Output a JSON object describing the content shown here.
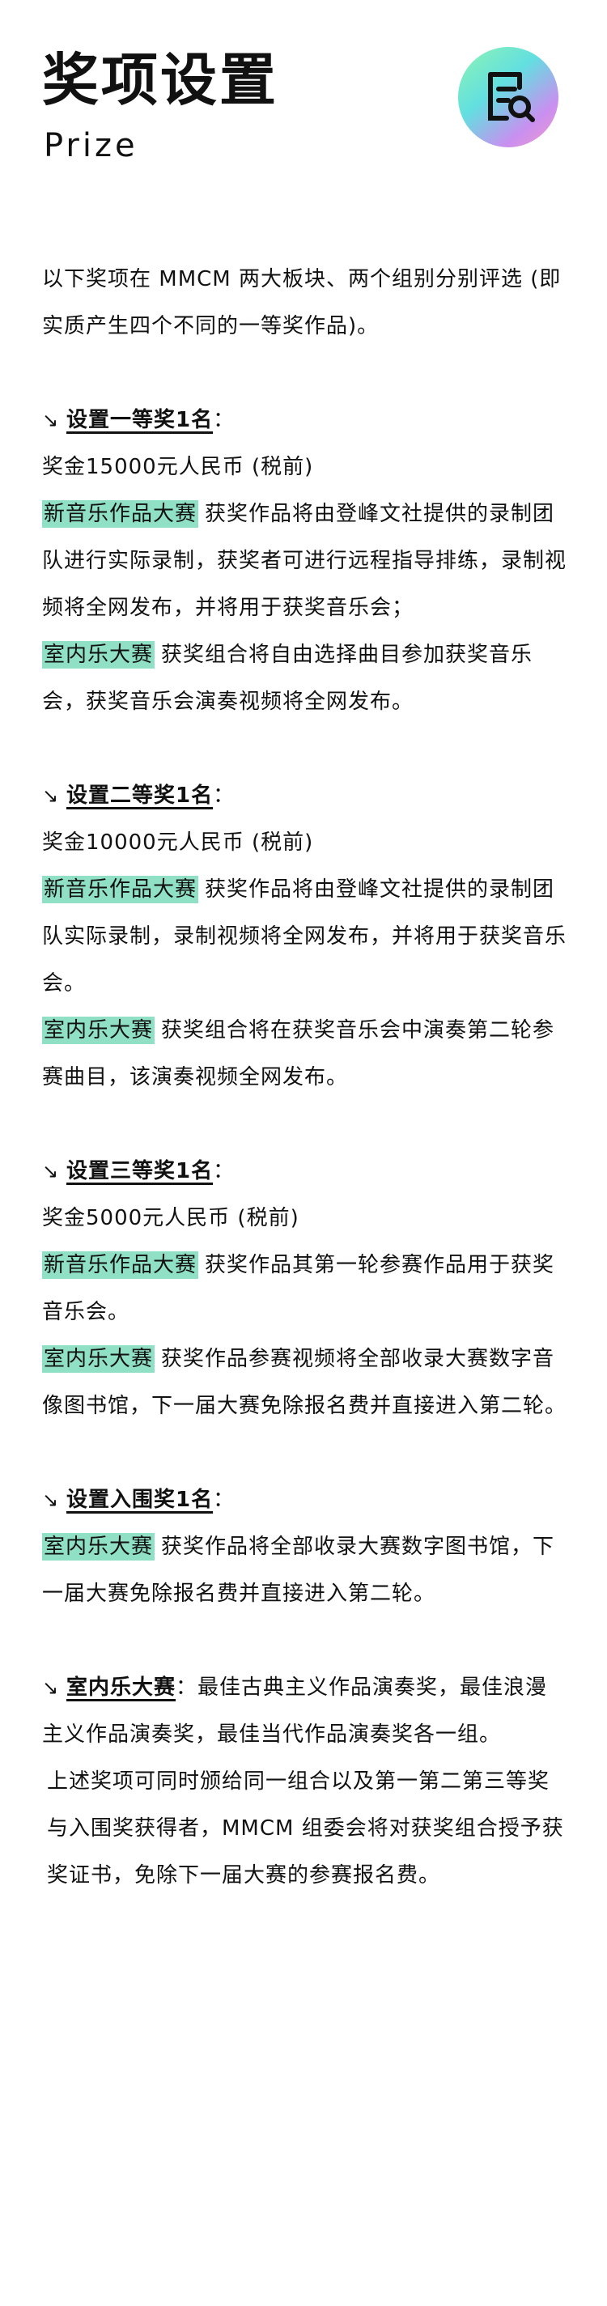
{
  "title": "奖项设置",
  "subtitle": "Prize",
  "intro": "以下奖项在 MMCM 两大板块、两个组别分别评选 (即实质产生四个不同的一等奖作品)。",
  "sections": [
    {
      "heading": "设置一等奖1名",
      "colon": "：",
      "prize": "奖金15000元人民币 (税前)",
      "items": [
        {
          "tag": "新音乐作品大赛",
          "text": "获奖作品将由登峰文社提供的录制团队进行实际录制，获奖者可进行远程指导排练，录制视频将全网发布，并将用于获奖音乐会；"
        },
        {
          "tag": "室内乐大赛",
          "text": "获奖组合将自由选择曲目参加获奖音乐会，获奖音乐会演奏视频将全网发布。"
        }
      ]
    },
    {
      "heading": "设置二等奖1名",
      "colon": "：",
      "prize": "奖金10000元人民币 (税前)",
      "items": [
        {
          "tag": "新音乐作品大赛",
          "text": "获奖作品将由登峰文社提供的录制团队实际录制，录制视频将全网发布，并将用于获奖音乐会。"
        },
        {
          "tag": "室内乐大赛",
          "text": "获奖组合将在获奖音乐会中演奏第二轮参赛曲目，该演奏视频全网发布。"
        }
      ]
    },
    {
      "heading": "设置三等奖1名",
      "colon": "：",
      "prize": "奖金5000元人民币 (税前)",
      "items": [
        {
          "tag": "新音乐作品大赛",
          "text": "获奖作品其第一轮参赛作品用于获奖音乐会。"
        },
        {
          "tag": "室内乐大赛",
          "text": "获奖作品参赛视频将全部收录大赛数字音像图书馆，下一届大赛免除报名费并直接进入第二轮。"
        }
      ]
    },
    {
      "heading": "设置入围奖1名",
      "colon": "：",
      "prize": "",
      "items": [
        {
          "tag": "室内乐大赛",
          "text": "获奖作品将全部收录大赛数字图书馆，下一届大赛免除报名费并直接进入第二轮。"
        }
      ]
    }
  ],
  "final": {
    "heading": "室内乐大赛",
    "colon": "：",
    "text": "最佳古典主义作品演奏奖，最佳浪漫主义作品演奏奖，最佳当代作品演奏奖各一组。",
    "note": "上述奖项可同时颁给同一组合以及第一第二第三等奖与入围奖获得者，MMCM 组委会将对获奖组合授予获奖证书，免除下一届大赛的参赛报名费。"
  },
  "arrow_glyph": "↘",
  "tag_color": "#8fe0c4",
  "logo_icon": "document-search-icon"
}
